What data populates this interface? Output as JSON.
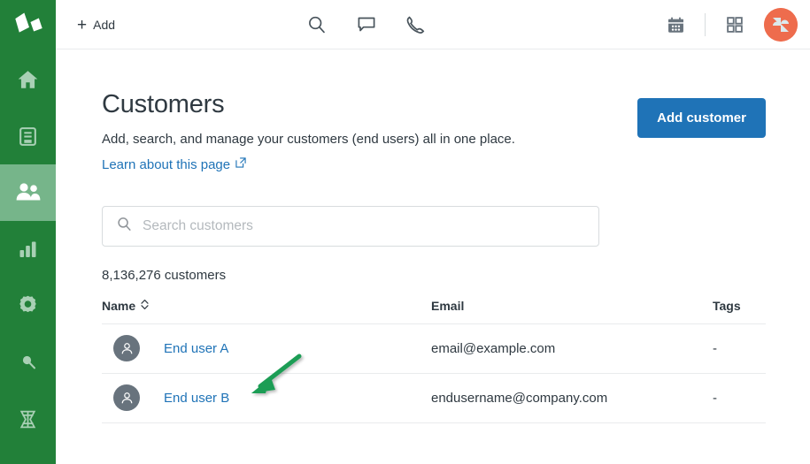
{
  "brand": {
    "rail_color": "#228039",
    "rail_active_color": "#76b58a",
    "accent_blue": "#1f73b7",
    "avatar_orange": "#ee6c4d",
    "annotation_green": "#1f9d55"
  },
  "sidebar": {
    "logo_name": "zendesk-logo",
    "items": [
      {
        "name": "home-icon",
        "label": "Home",
        "active": false
      },
      {
        "name": "views-icon",
        "label": "Views",
        "active": false
      },
      {
        "name": "customers-icon",
        "label": "Customers",
        "active": true
      },
      {
        "name": "reporting-icon",
        "label": "Reporting",
        "active": false
      },
      {
        "name": "admin-gear-icon",
        "label": "Admin",
        "active": false
      },
      {
        "name": "search-icon",
        "label": "Search",
        "active": false
      },
      {
        "name": "explore-icon",
        "label": "Explore",
        "active": false
      }
    ]
  },
  "topbar": {
    "add_label": "Add",
    "add_plus": "+",
    "center_icons": [
      {
        "name": "search-icon",
        "label": "Search"
      },
      {
        "name": "chat-icon",
        "label": "Chat"
      },
      {
        "name": "talk-icon",
        "label": "Talk"
      }
    ],
    "right_icons": [
      {
        "name": "calendar-icon",
        "label": "Calendar"
      },
      {
        "name": "apps-grid-icon",
        "label": "Products"
      }
    ],
    "avatar_name": "user-avatar"
  },
  "page": {
    "title": "Customers",
    "subtitle": "Add, search, and manage your customers (end users) all in one place.",
    "learn_link": "Learn about this page",
    "add_customer_label": "Add customer"
  },
  "search": {
    "placeholder": "Search customers",
    "value": ""
  },
  "list": {
    "count_label": "8,136,276 customers",
    "columns": {
      "name": "Name",
      "email": "Email",
      "tags": "Tags"
    },
    "rows": [
      {
        "name": "End user A",
        "email": "email@example.com",
        "tags": "-"
      },
      {
        "name": "End user B",
        "email": "endusername@company.com",
        "tags": "-"
      }
    ]
  },
  "annotation": {
    "type": "arrow",
    "points_to": "End user A"
  }
}
